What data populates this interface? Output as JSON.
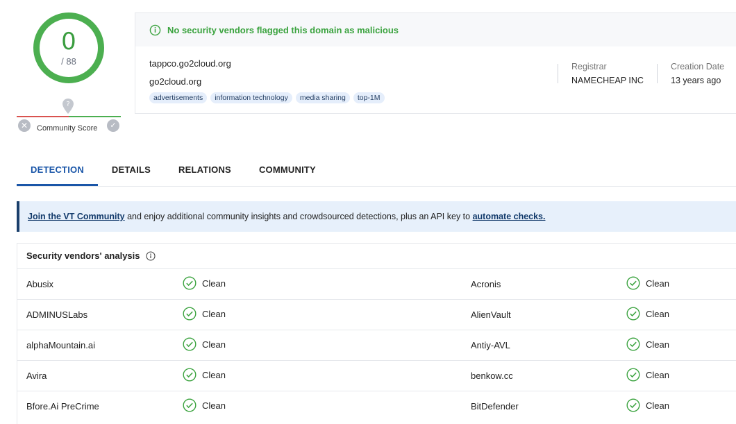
{
  "score": {
    "detected": "0",
    "total": "/ 88"
  },
  "community_score": {
    "label": "Community Score"
  },
  "banner": {
    "text": "No security vendors flagged this domain as malicious"
  },
  "domain": {
    "name": "tappco.go2cloud.org",
    "parent": "go2cloud.org",
    "tags": [
      "advertisements",
      "information technology",
      "media sharing",
      "top-1M"
    ]
  },
  "registrar": {
    "label": "Registrar",
    "value": "NAMECHEAP INC"
  },
  "creation_date": {
    "label": "Creation Date",
    "value": "13 years ago"
  },
  "tabs": [
    "DETECTION",
    "DETAILS",
    "RELATIONS",
    "COMMUNITY"
  ],
  "join_banner": {
    "link1": "Join the VT Community",
    "text": " and enjoy additional community insights and crowdsourced detections, plus an API key to ",
    "link2": "automate checks."
  },
  "analysis": {
    "title": "Security vendors' analysis",
    "rows": [
      {
        "left_vendor": "Abusix",
        "left_result": "Clean",
        "right_vendor": "Acronis",
        "right_result": "Clean"
      },
      {
        "left_vendor": "ADMINUSLabs",
        "left_result": "Clean",
        "right_vendor": "AlienVault",
        "right_result": "Clean"
      },
      {
        "left_vendor": "alphaMountain.ai",
        "left_result": "Clean",
        "right_vendor": "Antiy-AVL",
        "right_result": "Clean"
      },
      {
        "left_vendor": "Avira",
        "left_result": "Clean",
        "right_vendor": "benkow.cc",
        "right_result": "Clean"
      },
      {
        "left_vendor": "Bfore.Ai PreCrime",
        "left_result": "Clean",
        "right_vendor": "BitDefender",
        "right_result": "Clean"
      }
    ]
  },
  "colors": {
    "clean": "#3ba33f",
    "accent": "#1a56a8",
    "tag_bg": "#e5eefb"
  }
}
